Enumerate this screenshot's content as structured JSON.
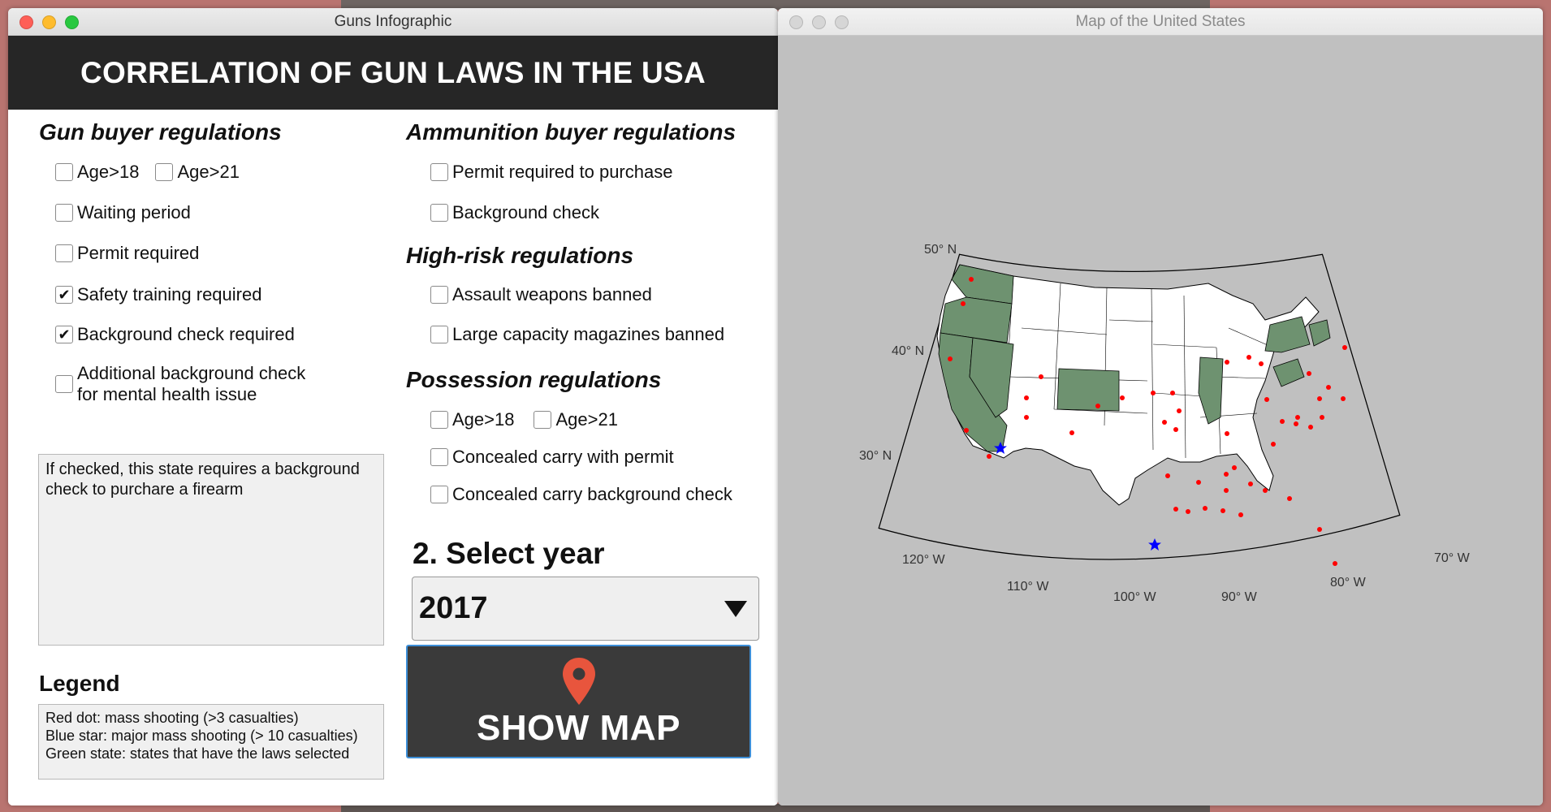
{
  "left_window": {
    "title": "Guns Infographic",
    "banner": "CORRELATION OF GUN LAWS IN THE USA",
    "gun_buyer": {
      "title": "Gun buyer regulations",
      "age18": {
        "label": "Age>18",
        "checked": false
      },
      "age21": {
        "label": "Age>21",
        "checked": false
      },
      "waiting": {
        "label": "Waiting period",
        "checked": false
      },
      "permit": {
        "label": "Permit required",
        "checked": false
      },
      "safety": {
        "label": "Safety training required",
        "checked": true
      },
      "background": {
        "label": "Background check required",
        "checked": true
      },
      "mental_line1": "Additional background check",
      "mental_line2": "for mental health issue",
      "mental_checked": false
    },
    "ammo": {
      "title": "Ammunition buyer regulations",
      "permit": {
        "label": "Permit required to purchase",
        "checked": false
      },
      "background": {
        "label": "Background check",
        "checked": false
      }
    },
    "high_risk": {
      "title": "High-risk regulations",
      "assault": {
        "label": "Assault weapons banned",
        "checked": false
      },
      "magazines": {
        "label": "Large capacity magazines banned",
        "checked": false
      }
    },
    "possession": {
      "title": "Possession regulations",
      "age18": {
        "label": "Age>18",
        "checked": false
      },
      "age21": {
        "label": "Age>21",
        "checked": false
      },
      "concealed_permit": {
        "label": "Concealed carry with permit",
        "checked": false
      },
      "concealed_bg": {
        "label": "Concealed carry background check",
        "checked": false
      }
    },
    "info_text": "If checked, this state requires a background check to purchare a firearm",
    "legend": {
      "title": "Legend",
      "line1": "Red dot: mass shooting (>3 casualties)",
      "line2": "Blue star: major mass shooting (> 10 casualties)",
      "line3": "Green state: states that have the laws selected"
    },
    "year": {
      "title": "2. Select year",
      "value": "2017"
    },
    "show_map": {
      "label": "SHOW MAP",
      "icon": "map-pin-icon"
    }
  },
  "right_window": {
    "title": "Map of the United States",
    "lat_labels": [
      "50° N",
      "40° N",
      "30° N"
    ],
    "lon_labels": [
      "120° W",
      "110° W",
      "100° W",
      "90° W",
      "80° W",
      "70° W"
    ],
    "highlighted_states": [
      "Washington",
      "Oregon",
      "California",
      "Nevada",
      "Colorado",
      "Illinois",
      "New York",
      "Pennsylvania",
      "New Jersey",
      "Maryland",
      "Delaware",
      "Connecticut",
      "Massachusetts",
      "Rhode Island"
    ]
  },
  "colors": {
    "state_highlight": "#6e9270",
    "state_default": "#ffffff",
    "dot": "#ff0000",
    "star": "#0000ff",
    "button_bg": "#3a3a3a",
    "button_border": "#3d8fd8",
    "pin": "#e8553d"
  }
}
